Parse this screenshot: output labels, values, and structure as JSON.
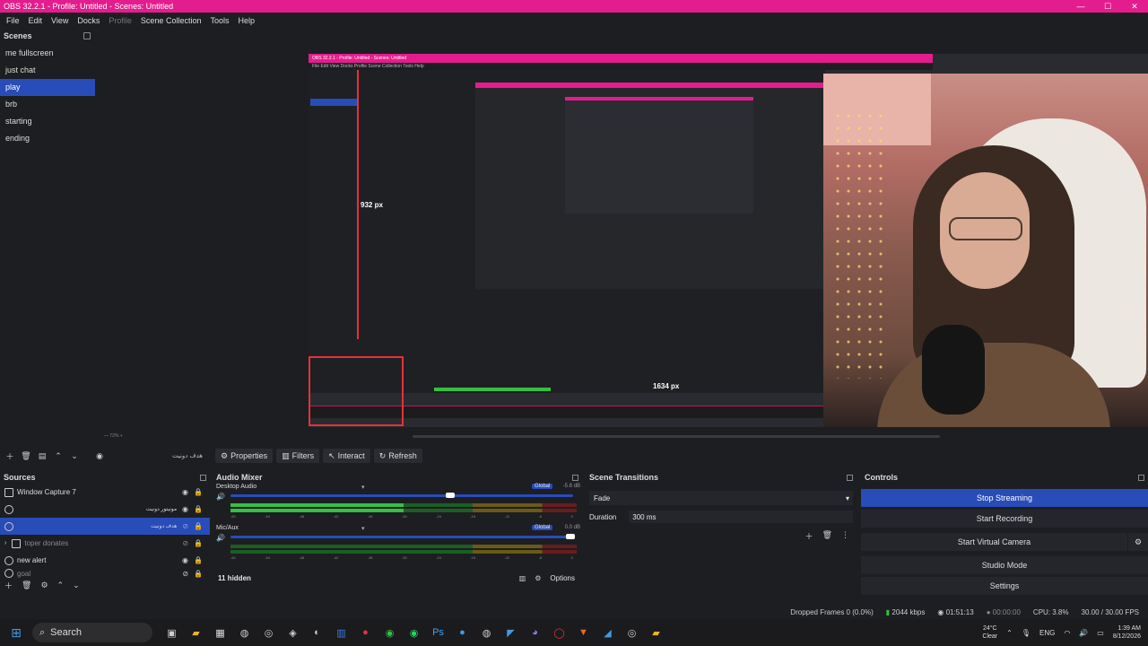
{
  "window": {
    "title": "OBS 32.2.1 - Profile: Untitled - Scenes: Untitled"
  },
  "menu": [
    "File",
    "Edit",
    "View",
    "Docks",
    "Profile",
    "Scene Collection",
    "Tools",
    "Help"
  ],
  "scenes": {
    "header": "Scenes",
    "items": [
      "me fullscreen",
      "just chat",
      "play",
      "brb",
      "starting",
      "ending"
    ],
    "active_index": 2
  },
  "preview": {
    "label_height": "932 px",
    "label_width": "1634 px",
    "inner_title": "OBS 32.2.1 - Profile: Untitled - Scenes: Untitled"
  },
  "source_toolbar": {
    "selected_source": "هدف دونیت",
    "properties": "Properties",
    "filters": "Filters",
    "interact": "Interact",
    "refresh": "Refresh"
  },
  "sources": {
    "header": "Sources",
    "items": [
      {
        "name": "Window Capture 7",
        "active": false
      },
      {
        "name": "مونیتور دونیت",
        "active": false
      },
      {
        "name": "هدف دونیت",
        "active": true
      },
      {
        "name": "toper donates",
        "active": false
      },
      {
        "name": "new alert",
        "active": false
      },
      {
        "name": "goal",
        "active": false
      }
    ]
  },
  "audio_mixer": {
    "header": "Audio Mixer",
    "channels": [
      {
        "name": "Desktop Audio",
        "db": "-5.8 dB",
        "global": "Global",
        "volume": 0.65,
        "level": 0.5
      },
      {
        "name": "Mic/Aux",
        "db": "0.0 dB",
        "global": "Global",
        "volume": 1.0,
        "level": 0.0
      }
    ],
    "ticks": [
      "-60",
      "-54",
      "-48",
      "-42",
      "-36",
      "-30",
      "-24",
      "-18",
      "-12",
      "-6",
      "0"
    ],
    "hidden": "11 hidden",
    "options": "Options"
  },
  "transitions": {
    "header": "Scene Transitions",
    "selected": "Fade",
    "duration_label": "Duration",
    "duration_value": "300 ms"
  },
  "controls": {
    "header": "Controls",
    "buttons": [
      "Stop Streaming",
      "Start Recording",
      "Start Virtual Camera",
      "Studio Mode",
      "Settings"
    ]
  },
  "status": {
    "dropped": "Dropped Frames 0 (0.0%)",
    "bitrate": "2044 kbps",
    "stream_time": "01:51:13",
    "rec_time": "00:00:00",
    "cpu": "CPU: 3.8%",
    "fps": "30.00 / 30.00 FPS"
  },
  "taskbar": {
    "search": "Search",
    "weather_temp": "24°C",
    "weather_desc": "Clear",
    "lang": "ENG",
    "time": "1:39 AM",
    "date": "8/12/2026"
  },
  "colors": {
    "accent": "#284cb8",
    "title": "#e41d8e",
    "meter": "#35c043"
  }
}
